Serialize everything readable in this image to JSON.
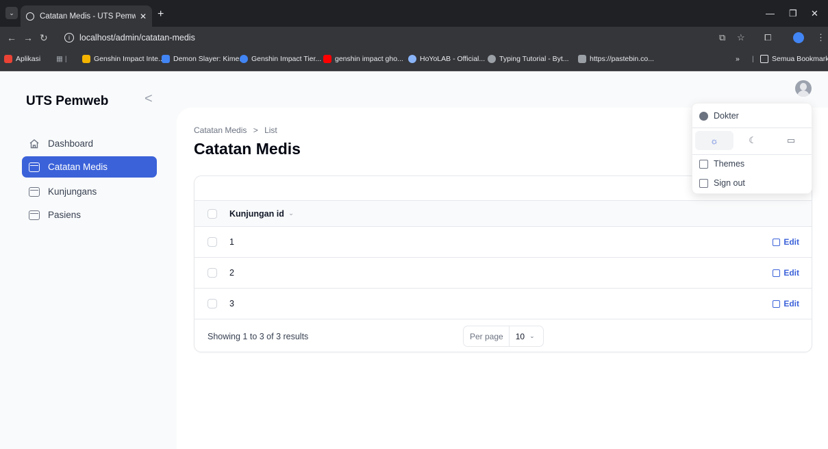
{
  "browser": {
    "tab_title": "Catatan Medis - UTS Pemweb",
    "tab_close": "✕",
    "new_tab": "+",
    "url": "localhost/admin/catatan-medis",
    "bookmarks": [
      {
        "label": "Aplikasi",
        "color": "#ea4335"
      },
      {
        "label": "Genshin Impact Inte...",
        "color": "#f4b400"
      },
      {
        "label": "Demon Slayer: Kime...",
        "color": "#4285f4"
      },
      {
        "label": "Genshin Impact Tier...",
        "color": "#4285f4"
      },
      {
        "label": "genshin impact gho...",
        "color": "#ff0000"
      },
      {
        "label": "HoYoLAB - Official...",
        "color": "#8ab4f8"
      },
      {
        "label": "Typing Tutorial - Byt...",
        "color": "#9aa0a6"
      },
      {
        "label": "https://pastebin.co...",
        "color": "#9aa0a6"
      }
    ],
    "more_bookmarks": "»",
    "all_bookmarks": "Semua Bookmark"
  },
  "sidebar": {
    "brand": "UTS Pemweb",
    "collapse": "<",
    "items": [
      {
        "label": "Dashboard",
        "active": false
      },
      {
        "label": "Catatan Medis",
        "active": true
      },
      {
        "label": "Kunjungans",
        "active": false
      },
      {
        "label": "Pasiens",
        "active": false
      }
    ]
  },
  "page": {
    "breadcrumb": [
      "Catatan Medis",
      ">",
      "List"
    ],
    "title": "Catatan Medis"
  },
  "table": {
    "column": "Kunjungan id",
    "rows": [
      {
        "value": "1",
        "action": "Edit"
      },
      {
        "value": "2",
        "action": "Edit"
      },
      {
        "value": "3",
        "action": "Edit"
      }
    ],
    "summary": "Showing 1 to 3 of 3 results",
    "per_page_label": "Per page",
    "per_page_value": "10"
  },
  "user_menu": {
    "name": "Dokter",
    "themes": "Themes",
    "sign_out": "Sign out"
  },
  "colors": {
    "primary": "#3b62d9",
    "chrome_dark": "#202124",
    "chrome": "#35363a"
  }
}
